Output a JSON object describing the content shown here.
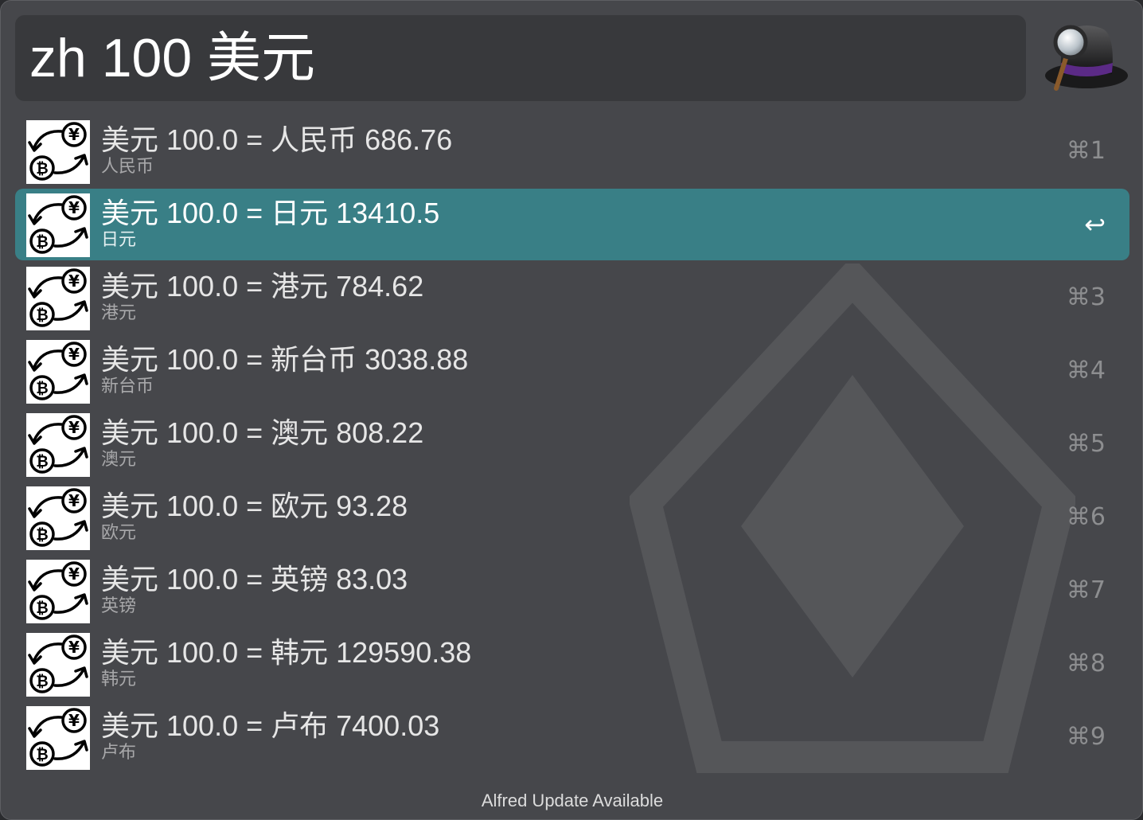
{
  "search": {
    "query": "zh 100 美元"
  },
  "results": [
    {
      "title": "美元 100.0 = 人民币 686.76",
      "subtitle": "人民币",
      "shortcut": "⌘1",
      "selected": false
    },
    {
      "title": "美元 100.0 = 日元 13410.5",
      "subtitle": "日元",
      "shortcut": "↩",
      "selected": true
    },
    {
      "title": "美元 100.0 = 港元 784.62",
      "subtitle": "港元",
      "shortcut": "⌘3",
      "selected": false
    },
    {
      "title": "美元 100.0 = 新台币 3038.88",
      "subtitle": "新台币",
      "shortcut": "⌘4",
      "selected": false
    },
    {
      "title": "美元 100.0 = 澳元 808.22",
      "subtitle": "澳元",
      "shortcut": "⌘5",
      "selected": false
    },
    {
      "title": "美元 100.0 = 欧元 93.28",
      "subtitle": "欧元",
      "shortcut": "⌘6",
      "selected": false
    },
    {
      "title": "美元 100.0 = 英镑 83.03",
      "subtitle": "英镑",
      "shortcut": "⌘7",
      "selected": false
    },
    {
      "title": "美元 100.0 = 韩元 129590.38",
      "subtitle": "韩元",
      "shortcut": "⌘8",
      "selected": false
    },
    {
      "title": "美元 100.0 = 卢布 7400.03",
      "subtitle": "卢布",
      "shortcut": "⌘9",
      "selected": false
    }
  ],
  "footer": {
    "status": "Alfred Update Available"
  },
  "icons": {
    "result_icon": "currency-exchange-icon",
    "app_logo": "alfred-hat-icon"
  },
  "colors": {
    "window_bg": "#46474b",
    "search_bg": "#38393c",
    "selection": "#397f86"
  }
}
